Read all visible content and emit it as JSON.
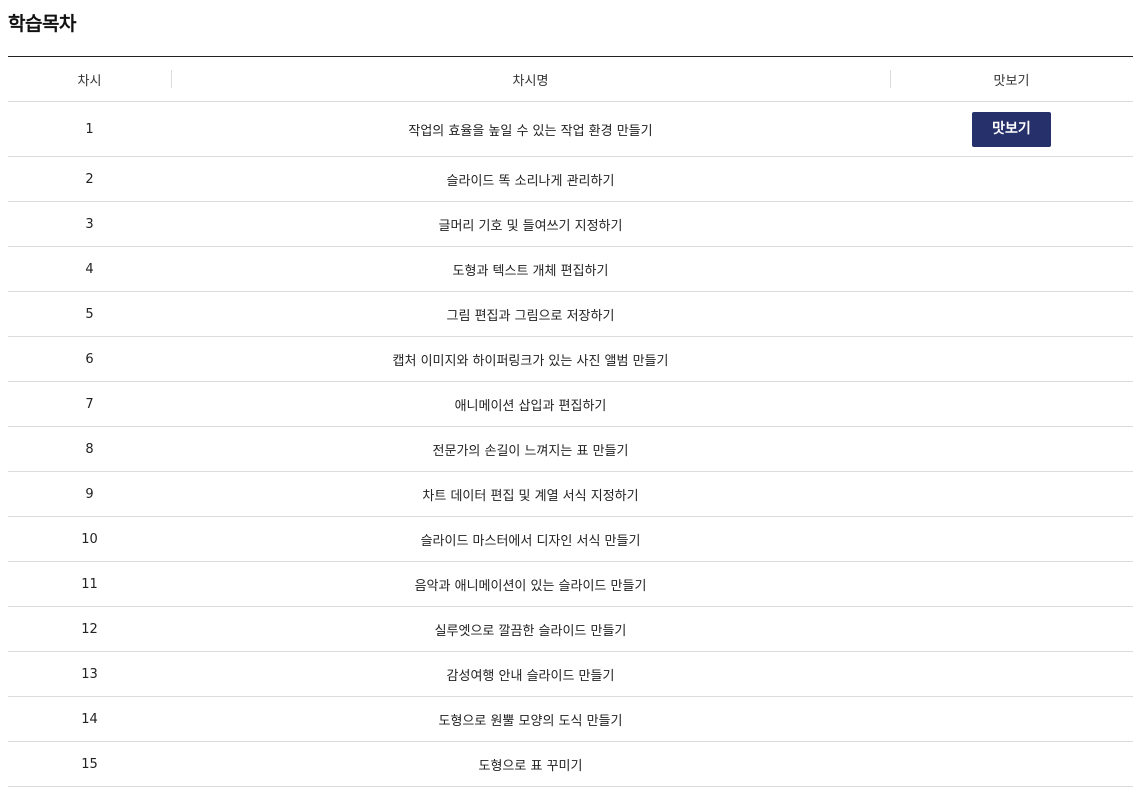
{
  "page": {
    "title": "학습목차"
  },
  "table": {
    "headers": {
      "number": "차시",
      "name": "차시명",
      "preview": "맛보기"
    },
    "preview_button_label": "맛보기",
    "rows": [
      {
        "number": "1",
        "name": "작업의 효율을 높일 수 있는 작업 환경 만들기",
        "has_preview": true
      },
      {
        "number": "2",
        "name": "슬라이드 똑 소리나게 관리하기",
        "has_preview": false
      },
      {
        "number": "3",
        "name": "글머리 기호 및 들여쓰기 지정하기",
        "has_preview": false
      },
      {
        "number": "4",
        "name": "도형과 텍스트 개체 편집하기",
        "has_preview": false
      },
      {
        "number": "5",
        "name": "그림 편집과 그림으로 저장하기",
        "has_preview": false
      },
      {
        "number": "6",
        "name": "캡처 이미지와 하이퍼링크가 있는 사진 앨범 만들기",
        "has_preview": false
      },
      {
        "number": "7",
        "name": "애니메이션 삽입과 편집하기",
        "has_preview": false
      },
      {
        "number": "8",
        "name": "전문가의 손길이 느껴지는 표 만들기",
        "has_preview": false
      },
      {
        "number": "9",
        "name": "차트 데이터 편집 및 계열 서식 지정하기",
        "has_preview": false
      },
      {
        "number": "10",
        "name": "슬라이드 마스터에서 디자인 서식 만들기",
        "has_preview": false
      },
      {
        "number": "11",
        "name": "음악과 애니메이션이 있는 슬라이드 만들기",
        "has_preview": false
      },
      {
        "number": "12",
        "name": "실루엣으로 깔끔한 슬라이드 만들기",
        "has_preview": false
      },
      {
        "number": "13",
        "name": "감성여행 안내 슬라이드 만들기",
        "has_preview": false
      },
      {
        "number": "14",
        "name": "도형으로 원뿔 모양의 도식 만들기",
        "has_preview": false
      },
      {
        "number": "15",
        "name": "도형으로 표 꾸미기",
        "has_preview": false
      }
    ]
  },
  "colors": {
    "button_bg": "#26306b",
    "button_text": "#ffffff",
    "header_border": "#222222",
    "row_border": "#dcdcdc"
  }
}
